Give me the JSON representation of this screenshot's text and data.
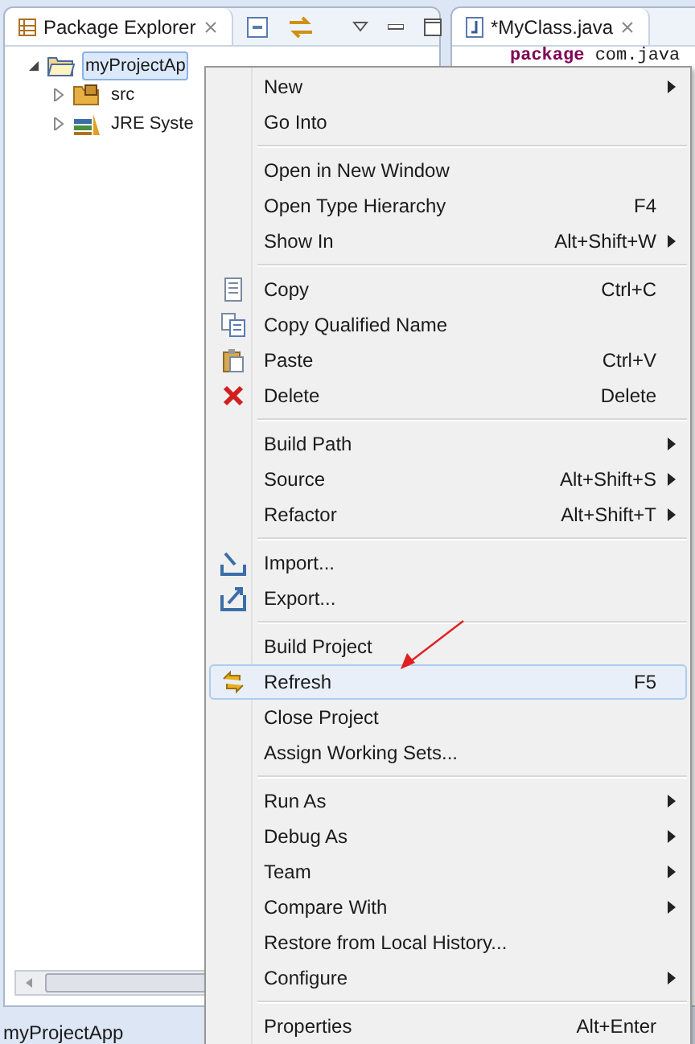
{
  "explorer": {
    "tab": "Package Explorer",
    "tree": [
      {
        "label": "myProjectAp",
        "kind": "project",
        "selected": true,
        "expanded": true,
        "children": [
          {
            "label": "src",
            "kind": "package",
            "expanded": false
          },
          {
            "label": "JRE Syste",
            "kind": "library",
            "expanded": false
          }
        ]
      }
    ]
  },
  "editor": {
    "tab": "*MyClass.java",
    "code_keyword": "package",
    "code_rest": "com.java"
  },
  "status_bar": "myProjectApp",
  "menu": [
    [
      {
        "label": "New",
        "submenu": true,
        "kind": "plain",
        "selected": false
      },
      {
        "label": "Go Into",
        "kind": "plain",
        "selected": false
      }
    ],
    [
      {
        "label": "Open in New Window",
        "kind": "plain",
        "selected": false
      },
      {
        "label": "Open Type Hierarchy",
        "shortcut": "F4",
        "kind": "plain",
        "selected": false
      },
      {
        "label": "Show In",
        "shortcut": "Alt+Shift+W",
        "submenu": true,
        "kind": "plain",
        "selected": false
      }
    ],
    [
      {
        "label": "Copy",
        "shortcut": "Ctrl+C",
        "kind": "copy",
        "selected": false
      },
      {
        "label": "Copy Qualified Name",
        "kind": "copy2",
        "selected": false
      },
      {
        "label": "Paste",
        "shortcut": "Ctrl+V",
        "kind": "paste",
        "selected": false
      },
      {
        "label": "Delete",
        "shortcut": "Delete",
        "kind": "delete",
        "selected": false
      }
    ],
    [
      {
        "label": "Build Path",
        "submenu": true,
        "kind": "plain",
        "selected": false
      },
      {
        "label": "Source",
        "shortcut": "Alt+Shift+S",
        "submenu": true,
        "kind": "plain",
        "selected": false
      },
      {
        "label": "Refactor",
        "shortcut": "Alt+Shift+T",
        "submenu": true,
        "kind": "plain",
        "selected": false
      }
    ],
    [
      {
        "label": "Import...",
        "kind": "import",
        "selected": false
      },
      {
        "label": "Export...",
        "kind": "export",
        "selected": false
      }
    ],
    [
      {
        "label": "Build Project",
        "kind": "plain",
        "selected": false
      },
      {
        "label": "Refresh",
        "shortcut": "F5",
        "kind": "refresh",
        "selected": true
      },
      {
        "label": "Close Project",
        "kind": "plain",
        "selected": false
      },
      {
        "label": "Assign Working Sets...",
        "kind": "plain",
        "selected": false
      }
    ],
    [
      {
        "label": "Run As",
        "submenu": true,
        "kind": "plain",
        "selected": false
      },
      {
        "label": "Debug As",
        "submenu": true,
        "kind": "plain",
        "selected": false
      },
      {
        "label": "Team",
        "submenu": true,
        "kind": "plain",
        "selected": false
      },
      {
        "label": "Compare With",
        "submenu": true,
        "kind": "plain",
        "selected": false
      },
      {
        "label": "Restore from Local History...",
        "kind": "plain",
        "selected": false
      },
      {
        "label": "Configure",
        "submenu": true,
        "kind": "plain",
        "selected": false
      }
    ],
    [
      {
        "label": "Properties",
        "shortcut": "Alt+Enter",
        "kind": "plain",
        "selected": false
      }
    ]
  ]
}
